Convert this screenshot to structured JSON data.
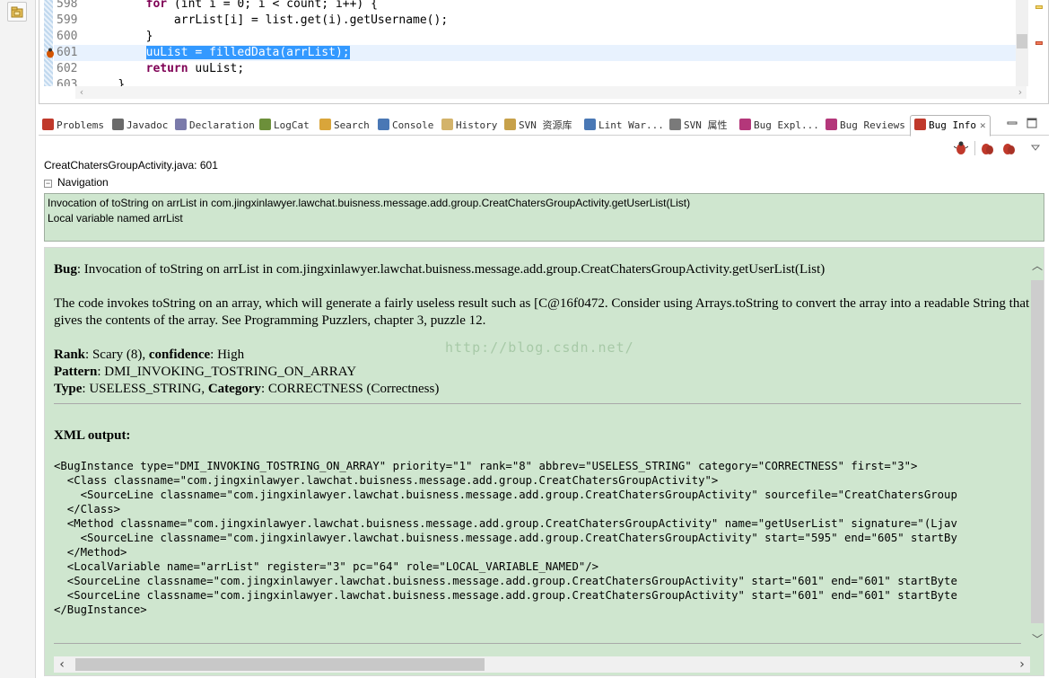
{
  "editor": {
    "lines": [
      {
        "num": "598",
        "indent": "        ",
        "kw": "for",
        "text": " (int i = 0; i < count; i++) {"
      },
      {
        "num": "599",
        "indent": "            ",
        "kw": "",
        "text": "arrList[i] = list.get(i).getUsername();"
      },
      {
        "num": "600",
        "indent": "        ",
        "kw": "",
        "text": "}"
      },
      {
        "num": "601",
        "indent": "        ",
        "kw": "",
        "text": "uuList = filledData(arrList);"
      },
      {
        "num": "602",
        "indent": "        ",
        "kw": "return",
        "text": " uuList;"
      },
      {
        "num": "603",
        "indent": "    ",
        "kw": "",
        "text": "}"
      }
    ],
    "highlighted_line": "601"
  },
  "tabs": [
    {
      "label": "Problems",
      "icon": "problems-icon",
      "color": "#c0392b"
    },
    {
      "label": "Javadoc",
      "icon": "at-icon",
      "color": "#6a6a6a"
    },
    {
      "label": "Declaration",
      "icon": "declaration-icon",
      "color": "#7a7aaa"
    },
    {
      "label": "LogCat",
      "icon": "logcat-icon",
      "color": "#6c8f3a"
    },
    {
      "label": "Search",
      "icon": "search-icon",
      "color": "#d9a53a"
    },
    {
      "label": "Console",
      "icon": "console-icon",
      "color": "#4a78b5"
    },
    {
      "label": "History",
      "icon": "history-icon",
      "color": "#d3b36a"
    },
    {
      "label": "SVN 资源库",
      "icon": "svn-repo-icon",
      "color": "#c7a14a"
    },
    {
      "label": "Lint War...",
      "icon": "lint-icon",
      "color": "#4a78b5"
    },
    {
      "label": "SVN 属性",
      "icon": "svn-props-icon",
      "color": "#7a7a7a"
    },
    {
      "label": "Bug Expl...",
      "icon": "bug-explorer-icon",
      "color": "#b4377a"
    },
    {
      "label": "Bug Reviews",
      "icon": "bug-reviews-icon",
      "color": "#b4377a"
    },
    {
      "label": "Bug Info",
      "icon": "bug-info-icon",
      "color": "#c0392b"
    }
  ],
  "active_tab": "Bug Info",
  "file_location": "CreatChatersGroupActivity.java: 601",
  "navigation": {
    "title": "Navigation",
    "items": [
      "Invocation of toString on arrList in com.jingxinlawyer.lawchat.buisness.message.add.group.CreatChatersGroupActivity.getUserList(List)",
      "Local variable named arrList"
    ]
  },
  "bug": {
    "bug_label": "Bug",
    "bug_text": ": Invocation of toString on arrList in com.jingxinlawyer.lawchat.buisness.message.add.group.CreatChatersGroupActivity.getUserList(List)",
    "description": "The code invokes toString on an array, which will generate a fairly useless result such as [C@16f0472. Consider using Arrays.toString to convert the array into a readable String that gives the contents of the array. See Programming Puzzlers, chapter 3, puzzle 12.",
    "rank_label": "Rank",
    "rank_value": ": Scary (8), ",
    "confidence_label": "confidence",
    "confidence_value": ": High",
    "pattern_label": "Pattern",
    "pattern_value": ": DMI_INVOKING_TOSTRING_ON_ARRAY",
    "type_label": "Type",
    "type_value": ": USELESS_STRING, ",
    "category_label": "Category",
    "category_value": ": CORRECTNESS (Correctness)",
    "xml_title": "XML output:",
    "xml": "<BugInstance type=\"DMI_INVOKING_TOSTRING_ON_ARRAY\" priority=\"1\" rank=\"8\" abbrev=\"USELESS_STRING\" category=\"CORRECTNESS\" first=\"3\">\n  <Class classname=\"com.jingxinlawyer.lawchat.buisness.message.add.group.CreatChatersGroupActivity\">\n    <SourceLine classname=\"com.jingxinlawyer.lawchat.buisness.message.add.group.CreatChatersGroupActivity\" sourcefile=\"CreatChatersGroup\n  </Class>\n  <Method classname=\"com.jingxinlawyer.lawchat.buisness.message.add.group.CreatChatersGroupActivity\" name=\"getUserList\" signature=\"(Ljav\n    <SourceLine classname=\"com.jingxinlawyer.lawchat.buisness.message.add.group.CreatChatersGroupActivity\" start=\"595\" end=\"605\" startBy\n  </Method>\n  <LocalVariable name=\"arrList\" register=\"3\" pc=\"64\" role=\"LOCAL_VARIABLE_NAMED\"/>\n  <SourceLine classname=\"com.jingxinlawyer.lawchat.buisness.message.add.group.CreatChatersGroupActivity\" start=\"601\" end=\"601\" startByte\n  <SourceLine classname=\"com.jingxinlawyer.lawchat.buisness.message.add.group.CreatChatersGroupActivity\" start=\"601\" end=\"601\" startByte\n</BugInstance>"
  },
  "watermark": "http://blog.csdn.net/",
  "colors": {
    "panel_green": "#cfe6cf",
    "selection": "#3399ff"
  }
}
